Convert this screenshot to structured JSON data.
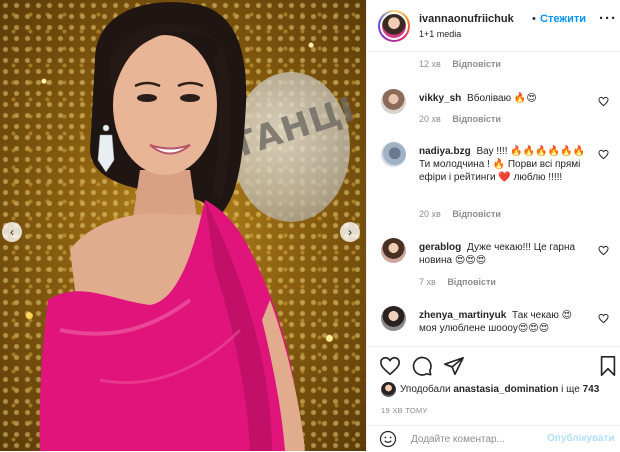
{
  "post": {
    "author": {
      "username": "ivannaonufriichuk",
      "separator": "•",
      "follow_label": "Стежити",
      "subtitle": "1+1 media"
    },
    "media": {
      "description_icons": {
        "prev": "chevron-left-icon",
        "next": "chevron-right-icon"
      },
      "prev_glyph": "‹",
      "next_glyph": "›",
      "logo_text": "ТАНЦІ"
    },
    "caption_meta": {
      "time": "12 хв",
      "reply": "Відповісти"
    },
    "comments": [
      {
        "user": "vikky_sh",
        "text": "Вболіваю 🔥😍",
        "time": "20 хв",
        "reply": "Відповісти"
      },
      {
        "user": "nadiya.bzg",
        "text": "Вау !!!! 🔥🔥🔥🔥🔥🔥 Ти молодчина ! 🔥 Порви всі прямі ефіри і рейтинги ❤️ люблю !!!!!",
        "time": "20 хв",
        "reply": "Відповісти"
      },
      {
        "user": "gerablog",
        "text": "Дуже чекаю!!! Це гарна новина 😍😍😍",
        "time": "7 хв",
        "reply": "Відповісти"
      },
      {
        "user": "zhenya_martinyuk",
        "text": "Так чекаю 😍 моя улюблене шоооу😍😍😍",
        "time": "",
        "reply": ""
      }
    ],
    "likes": {
      "prefix": "Уподобали",
      "user": "anastasia_domination",
      "middle": "і ще",
      "count": "743"
    },
    "time_ago": "19 ХВ ТОМУ",
    "add_comment": {
      "placeholder": "Додайте коментар...",
      "publish_label": "Опублікувати"
    },
    "colors": {
      "accent": "#0095f6",
      "publish_disabled": "#b2dffc",
      "muted": "#8e8e8e",
      "dress": "#e0147a"
    }
  }
}
